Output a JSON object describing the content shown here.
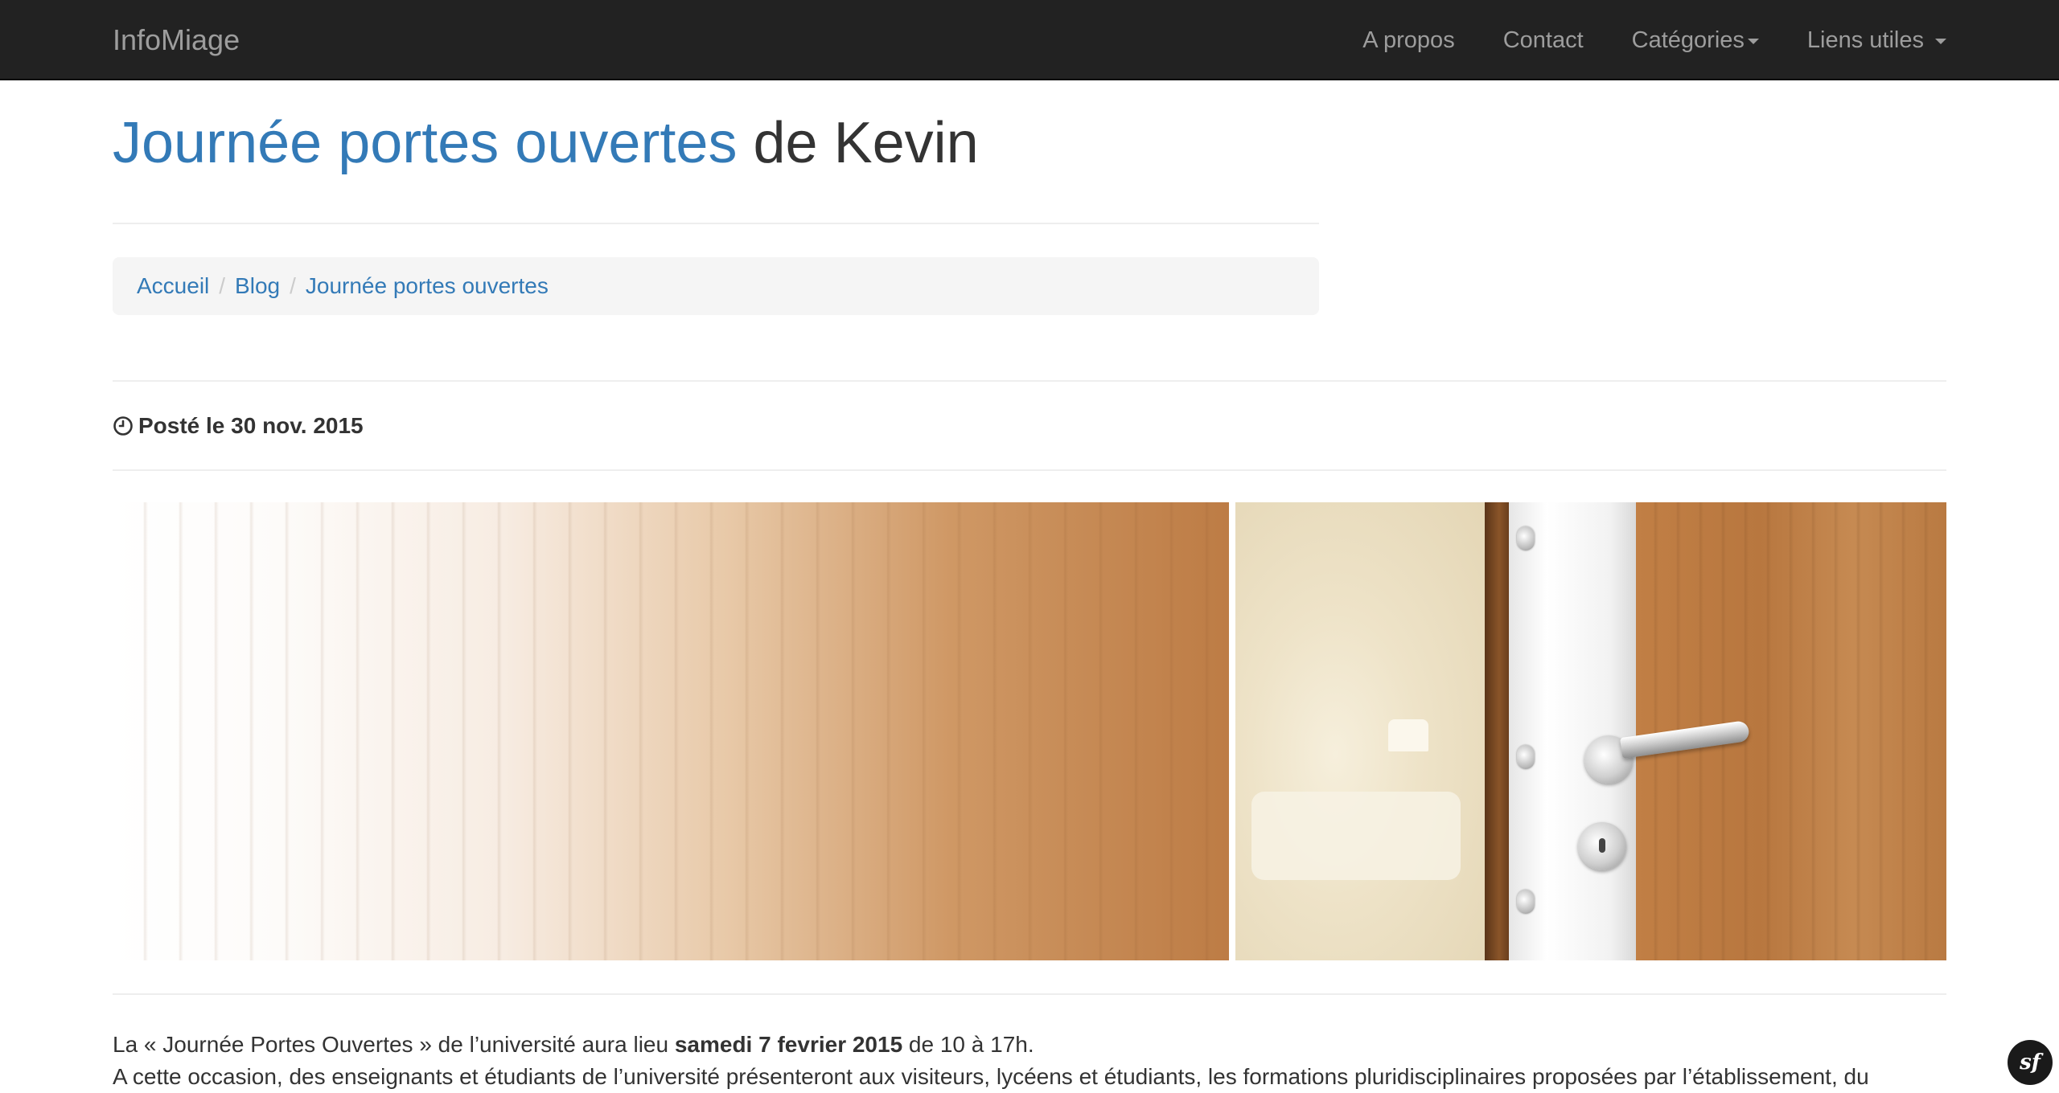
{
  "navbar": {
    "brand": "InfoMiage",
    "items": [
      {
        "label": "A propos"
      },
      {
        "label": "Contact"
      },
      {
        "label": "Catégories"
      },
      {
        "label": "Liens utiles"
      }
    ]
  },
  "header": {
    "title_accent": "Journée portes ouvertes",
    "title_rest": "de Kevin"
  },
  "breadcrumb": {
    "items": [
      "Accueil",
      "Blog",
      "Journée portes ouvertes"
    ],
    "separator": "/"
  },
  "post": {
    "icon": "clock-icon",
    "posted": "Posté le 30 nov. 2015"
  },
  "hero": {
    "image": "door-handle-photo"
  },
  "article": {
    "line1_before": "La « Journée Portes Ouvertes » de l’université aura lieu ",
    "line1_bold": "samedi 7 fevrier 2015",
    "line1_after": " de 10 à 17h.",
    "line2": "A cette occasion, des enseignants et étudiants de l’université présenteront aux visiteurs, lycéens et étudiants, les formations pluridisciplinaires proposées par l’établissement, du"
  },
  "toolbar_badge": {
    "label": "sf",
    "icon": "symfony-icon"
  },
  "colors": {
    "navbar_bg": "#222222",
    "nav_text": "#9d9d9d",
    "link": "#337ab7",
    "text": "#333333",
    "breadcrumb_bg": "#f5f5f5"
  }
}
